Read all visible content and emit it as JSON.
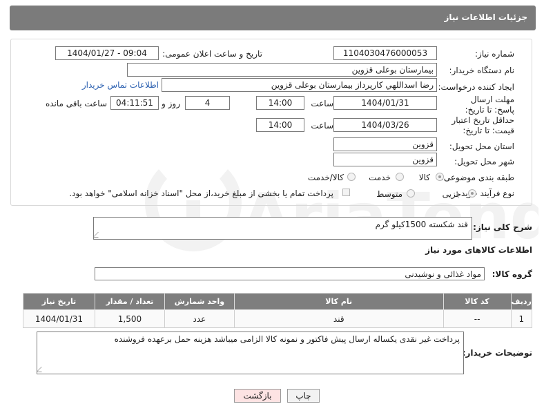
{
  "header": {
    "title": "جزئیات اطلاعات نیاز"
  },
  "fields": {
    "need_number_label": "شماره نیاز:",
    "need_number": "1104030476000053",
    "announce_label": "تاریخ و ساعت اعلان عمومی:",
    "announce_value": "1404/01/27 - 09:04",
    "buyer_org_label": "نام دستگاه خریدار:",
    "buyer_org": "بیمارستان بوعلی قزوین",
    "creator_label": "ایجاد کننده درخواست:",
    "creator": "رضا اسداللهي كارپرداز بيمارستان بوعلی قزوین",
    "contact_link": "اطلاعات تماس خریدار",
    "deadline_label": "مهلت ارسال پاسخ: تا تاریخ:",
    "deadline_date": "1404/01/31",
    "time_label": "ساعت",
    "deadline_time": "14:00",
    "days_value": "4",
    "days_label": "روز و",
    "remaining_time": "04:11:51",
    "remaining_label": "ساعت باقی مانده",
    "price_validity_label": "حداقل تاریخ اعتبار قیمت: تا تاریخ:",
    "price_validity_date": "1404/03/26",
    "price_validity_time": "14:00",
    "province_label": "استان محل تحویل:",
    "province": "قزوین",
    "city_label": "شهر محل تحویل:",
    "city": "قزوین",
    "category_label": "طبقه بندی موضوعی:",
    "category_options": [
      "کالا",
      "خدمت",
      "کالا/خدمت"
    ],
    "process_label": "نوع فرآیند خرید :",
    "process_options": [
      "جزیی",
      "متوسط"
    ],
    "treasury_note": "پرداخت تمام یا بخشی از مبلغ خرید،از محل \"اسناد خزانه اسلامی\" خواهد بود."
  },
  "description": {
    "label": "شرح کلی نیاز:",
    "value": "قند شکسته 1500کیلو گرم"
  },
  "goods_info": {
    "title": "اطلاعات کالاهای مورد نیاز",
    "group_label": "گروه کالا:",
    "group_value": "مواد غذائی و نوشیدنی"
  },
  "table": {
    "headers": [
      "ردیف",
      "کد کالا",
      "نام کالا",
      "واحد شمارش",
      "تعداد / مقدار",
      "تاریخ نیاز"
    ],
    "rows": [
      [
        "1",
        "--",
        "قند",
        "عدد",
        "1,500",
        "1404/01/31"
      ]
    ]
  },
  "buyer_notes": {
    "label": "توضیحات خریدار:",
    "value": "پرداخت غیر نقدی یکساله ارسال پیش فاکتور و نمونه کالا الزامی میباشد هزینه حمل برعهده فروشنده"
  },
  "buttons": {
    "print": "چاپ",
    "back": "بازگشت"
  },
  "watermark_text": "AriaTender.neT",
  "colors": {
    "header": "#7b7b7b",
    "link": "#2a5fb0",
    "back_button": "#fde3e3"
  }
}
